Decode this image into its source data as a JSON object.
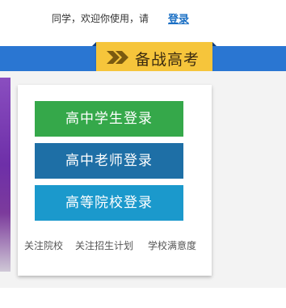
{
  "header": {
    "welcome_text": "同学，欢迎你使用，请",
    "login_link": "登录"
  },
  "banner": {
    "title": "备战高考",
    "icon": "double-chevron-right-icon"
  },
  "login_buttons": [
    {
      "label": "高中学生登录"
    },
    {
      "label": "高中老师登录"
    },
    {
      "label": "高等院校登录"
    }
  ],
  "footer_links": [
    {
      "label": "关注院校"
    },
    {
      "label": "关注招生计划"
    },
    {
      "label": "学校满意度"
    }
  ],
  "colors": {
    "nav_blue": "#2a76d2",
    "banner_yellow": "#f6c53b",
    "student_green": "#35a84a",
    "teacher_blue": "#1e6fa6",
    "college_cyan": "#1b99cc",
    "link_blue": "#1a6fc4"
  }
}
